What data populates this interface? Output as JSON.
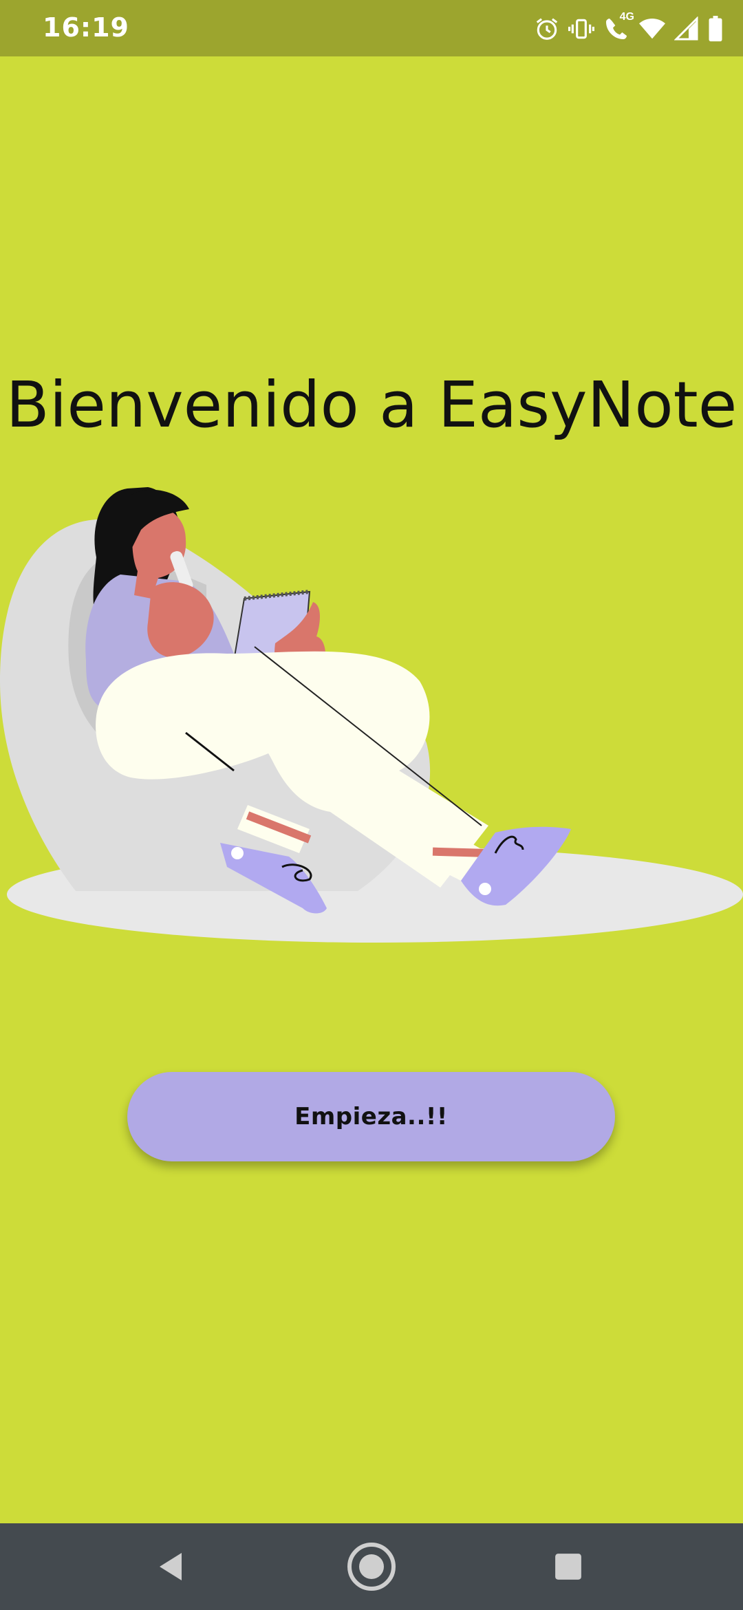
{
  "status_bar": {
    "time": "16:19",
    "icons": [
      "alarm-icon",
      "vibrate-icon",
      "wifi-calling-icon",
      "wifi-icon",
      "cell-signal-icon",
      "battery-icon"
    ],
    "network_badge": "4G"
  },
  "welcome": {
    "title": "Bienvenido a EasyNote"
  },
  "illustration": {
    "name": "woman-writing-notes-illustration"
  },
  "actions": {
    "start_label": "Empieza..!!"
  },
  "nav_bar": {
    "buttons": [
      "back-icon",
      "home-icon",
      "recents-icon"
    ]
  },
  "colors": {
    "background": "#CDDC39",
    "status_bar": "#9CA52E",
    "button": "#B1A9E5",
    "nav_bar": "#444A4F"
  }
}
